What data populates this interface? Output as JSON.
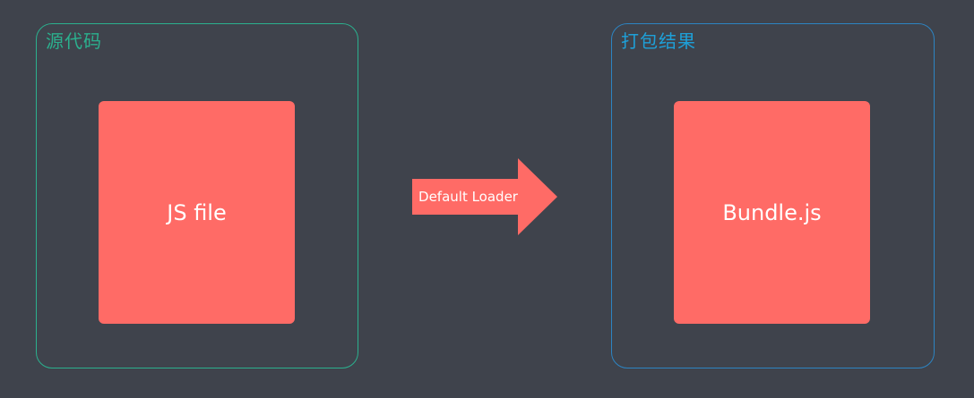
{
  "diagram": {
    "source_group": {
      "title": "源代码",
      "file_label": "JS file"
    },
    "transform": {
      "label": "Default Loader"
    },
    "output_group": {
      "title": "打包结果",
      "file_label": "Bundle.js"
    }
  },
  "colors": {
    "background": "#3f434c",
    "source_border": "#2bb08e",
    "output_border": "#2d84c2",
    "output_title": "#1ea0d8",
    "box_fill": "#ff6b66",
    "text_on_box": "#ffffff"
  }
}
